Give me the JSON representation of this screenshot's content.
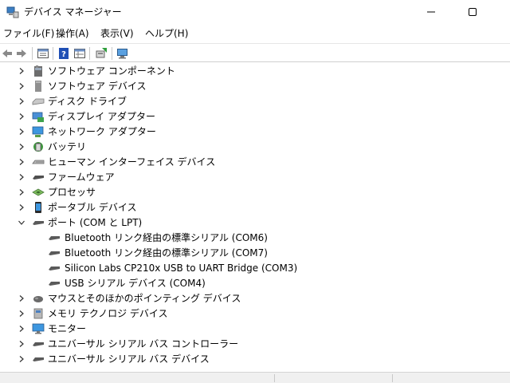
{
  "window": {
    "title": "デバイス マネージャー"
  },
  "menu": [
    {
      "label": "ファイル(F)"
    },
    {
      "label": "操作(A)"
    },
    {
      "label": "表示(V)"
    },
    {
      "label": "ヘルプ(H)"
    }
  ],
  "toolbar_icons": [
    "back-arrow-icon",
    "forward-arrow-icon",
    "properties-view-icon",
    "help-icon",
    "details-view-icon",
    "update-driver-icon",
    "scan-hardware-icon"
  ],
  "tree": [
    {
      "label": "ソフトウェア コンポーネント",
      "icon": "software-component-icon",
      "expanded": false
    },
    {
      "label": "ソフトウェア デバイス",
      "icon": "software-device-icon",
      "expanded": false
    },
    {
      "label": "ディスク ドライブ",
      "icon": "disk-drive-icon",
      "expanded": false
    },
    {
      "label": "ディスプレイ アダプター",
      "icon": "display-adapter-icon",
      "expanded": false
    },
    {
      "label": "ネットワーク アダプター",
      "icon": "network-adapter-icon",
      "expanded": false
    },
    {
      "label": "バッテリ",
      "icon": "battery-icon",
      "expanded": false
    },
    {
      "label": "ヒューマン インターフェイス デバイス",
      "icon": "hid-icon",
      "expanded": false
    },
    {
      "label": "ファームウェア",
      "icon": "firmware-icon",
      "expanded": false
    },
    {
      "label": "プロセッサ",
      "icon": "processor-icon",
      "expanded": false
    },
    {
      "label": "ポータブル デバイス",
      "icon": "portable-device-icon",
      "expanded": false
    },
    {
      "label": "ポート (COM と LPT)",
      "icon": "port-icon",
      "expanded": true,
      "children": [
        {
          "label": "Bluetooth リンク経由の標準シリアル (COM6)",
          "icon": "port-icon"
        },
        {
          "label": "Bluetooth リンク経由の標準シリアル (COM7)",
          "icon": "port-icon"
        },
        {
          "label": "Silicon Labs CP210x USB to UART Bridge (COM3)",
          "icon": "port-icon"
        },
        {
          "label": "USB シリアル デバイス (COM4)",
          "icon": "port-icon"
        }
      ]
    },
    {
      "label": "マウスとそのほかのポインティング デバイス",
      "icon": "mouse-icon",
      "expanded": false
    },
    {
      "label": "メモリ テクノロジ デバイス",
      "icon": "memory-device-icon",
      "expanded": false
    },
    {
      "label": "モニター",
      "icon": "monitor-icon",
      "expanded": false
    },
    {
      "label": "ユニバーサル シリアル バス コントローラー",
      "icon": "usb-controller-icon",
      "expanded": false
    },
    {
      "label": "ユニバーサル シリアル バス デバイス",
      "icon": "usb-device-icon",
      "expanded": false
    }
  ]
}
